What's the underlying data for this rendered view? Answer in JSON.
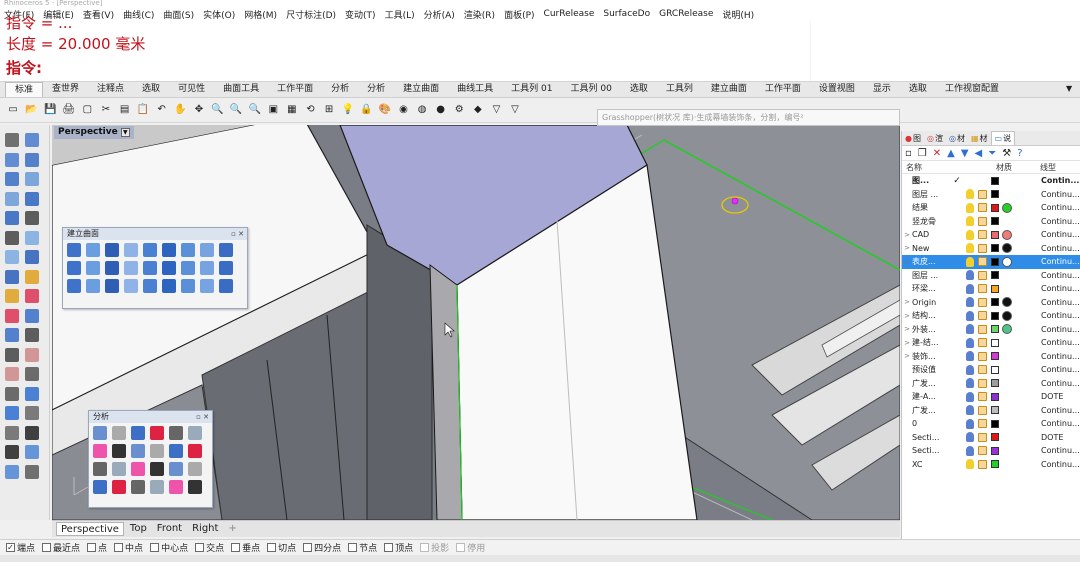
{
  "window": {
    "title_strip": "Rhinoceros 5 - [Perspective]"
  },
  "menubar": [
    "文件(F)",
    "编辑(E)",
    "查看(V)",
    "曲线(C)",
    "曲面(S)",
    "实体(O)",
    "网格(M)",
    "尺寸标注(D)",
    "变动(T)",
    "工具(L)",
    "分析(A)",
    "渲染(R)",
    "面板(P)",
    "CurRelease",
    "SurfaceDo",
    "GRCRelease",
    "说明(H)"
  ],
  "command_history": {
    "length_line": "长度 = 20.000 毫米",
    "prompt": "指令:"
  },
  "tabs": [
    "标准",
    "查世界",
    "注释点",
    "选取",
    "可见性",
    "曲面工具",
    "工作平面",
    "分析",
    "分析",
    "建立曲面",
    "曲线工具",
    "工具列 01",
    "工具列 00",
    "选取",
    "工具列",
    "建立曲面",
    "工作平面",
    "设置视图",
    "显示",
    "选取",
    "工作视窗配置"
  ],
  "tooltip": "Grasshopper(树状况 库)·生成幕墙装饰条，分割，编号²",
  "viewport": {
    "label": "Perspective",
    "colors": {
      "background": "#7b7d86",
      "highlight_face": "#a7a7d6",
      "selection": "#19d219"
    }
  },
  "panels": {
    "surface": {
      "title": "建立曲面"
    },
    "analysis": {
      "title": "分析"
    }
  },
  "view_tabs": [
    "Perspective",
    "Top",
    "Front",
    "Right",
    "+"
  ],
  "layer_panel": {
    "tabs": [
      "图",
      "渲",
      "材",
      "材",
      "说"
    ],
    "columns": {
      "name": "名称",
      "material": "材质",
      "linetype": "线型"
    },
    "rows": [
      {
        "expand": "",
        "name": "图...",
        "current": "✓",
        "bulb": "",
        "lock": "",
        "color": "#000000",
        "material": "",
        "linetype": "Contin...",
        "bold": true
      },
      {
        "expand": "",
        "name": "图层 ...",
        "current": "",
        "bulb": "on",
        "lock": "y",
        "color": "#000000",
        "material": "",
        "linetype": "Continu..."
      },
      {
        "expand": "",
        "name": "结果",
        "current": "",
        "bulb": "on",
        "lock": "y",
        "color": "#e01717",
        "material": "#26d126",
        "linetype": "Continu..."
      },
      {
        "expand": "",
        "name": "竖龙骨",
        "current": "",
        "bulb": "on",
        "lock": "y",
        "color": "#000000",
        "material": "",
        "linetype": "Continu..."
      },
      {
        "expand": ">",
        "name": "CAD",
        "current": "",
        "bulb": "on",
        "lock": "y",
        "color": "#ea6b6b",
        "material": "#f07b7b",
        "linetype": "Continu..."
      },
      {
        "expand": ">",
        "name": "New",
        "current": "",
        "bulb": "on",
        "lock": "y",
        "color": "#000000",
        "material": "#111111",
        "linetype": "Continu..."
      },
      {
        "expand": ">",
        "name": "表皮...",
        "current": "",
        "bulb": "on",
        "lock": "y",
        "color": "#000000",
        "material": "#ffffff",
        "linetype": "Continu...",
        "selected": true
      },
      {
        "expand": "",
        "name": "图层 ...",
        "current": "",
        "bulb": "",
        "lock": "y",
        "color": "#000000",
        "material": "",
        "linetype": "Continu..."
      },
      {
        "expand": "",
        "name": "环梁...",
        "current": "",
        "bulb": "",
        "lock": "y",
        "color": "#f5a623",
        "material": "",
        "linetype": "Continu..."
      },
      {
        "expand": ">",
        "name": "Origin",
        "current": "",
        "bulb": "",
        "lock": "y",
        "color": "#000000",
        "material": "#111111",
        "linetype": "Continu..."
      },
      {
        "expand": ">",
        "name": "结构...",
        "current": "",
        "bulb": "",
        "lock": "y",
        "color": "#000000",
        "material": "#111111",
        "linetype": "Continu..."
      },
      {
        "expand": ">",
        "name": "外装...",
        "current": "",
        "bulb": "",
        "lock": "y",
        "color": "#6cd36c",
        "material": "#4fc48a",
        "linetype": "Continu..."
      },
      {
        "expand": ">",
        "name": "建-结...",
        "current": "",
        "bulb": "",
        "lock": "y",
        "color": "#ffffff",
        "material": "",
        "linetype": "Continu..."
      },
      {
        "expand": ">",
        "name": "装饰...",
        "current": "",
        "bulb": "",
        "lock": "y",
        "color": "#d63ad6",
        "material": "",
        "linetype": "Continu..."
      },
      {
        "expand": "",
        "name": "预设值",
        "current": "",
        "bulb": "",
        "lock": "y",
        "color": "#ffffff",
        "material": "",
        "linetype": "Continu..."
      },
      {
        "expand": "",
        "name": "广发...",
        "current": "",
        "bulb": "",
        "lock": "y",
        "color": "#9e9e9e",
        "material": "",
        "linetype": "Continu..."
      },
      {
        "expand": "",
        "name": "建-A...",
        "current": "",
        "bulb": "",
        "lock": "y",
        "color": "#8c2fd4",
        "material": "",
        "linetype": "DOTE"
      },
      {
        "expand": "",
        "name": "广发...",
        "current": "",
        "bulb": "",
        "lock": "y",
        "color": "#bdbdbd",
        "material": "",
        "linetype": "Continu..."
      },
      {
        "expand": "",
        "name": "0",
        "current": "",
        "bulb": "",
        "lock": "y",
        "color": "#000000",
        "material": "",
        "linetype": "Continu..."
      },
      {
        "expand": "",
        "name": "Secti...",
        "current": "",
        "bulb": "",
        "lock": "y",
        "color": "#e01717",
        "material": "",
        "linetype": "DOTE"
      },
      {
        "expand": "",
        "name": "Secti...",
        "current": "",
        "bulb": "",
        "lock": "y",
        "color": "#9b2fd8",
        "material": "",
        "linetype": "Continu..."
      },
      {
        "expand": "",
        "name": "XC",
        "current": "",
        "bulb": "on",
        "lock": "y",
        "color": "#26d126",
        "material": "",
        "linetype": "Continu..."
      }
    ]
  },
  "osnap": [
    {
      "label": "端点",
      "checked": true
    },
    {
      "label": "最近点",
      "checked": false
    },
    {
      "label": "点",
      "checked": false
    },
    {
      "label": "中点",
      "checked": false
    },
    {
      "label": "中心点",
      "checked": false
    },
    {
      "label": "交点",
      "checked": false
    },
    {
      "label": "垂点",
      "checked": false
    },
    {
      "label": "切点",
      "checked": false
    },
    {
      "label": "四分点",
      "checked": false
    },
    {
      "label": "节点",
      "checked": false
    },
    {
      "label": "顶点",
      "checked": false
    },
    {
      "label": "投影",
      "checked": false,
      "disabled": true
    },
    {
      "label": "停用",
      "checked": false,
      "disabled": true
    }
  ]
}
